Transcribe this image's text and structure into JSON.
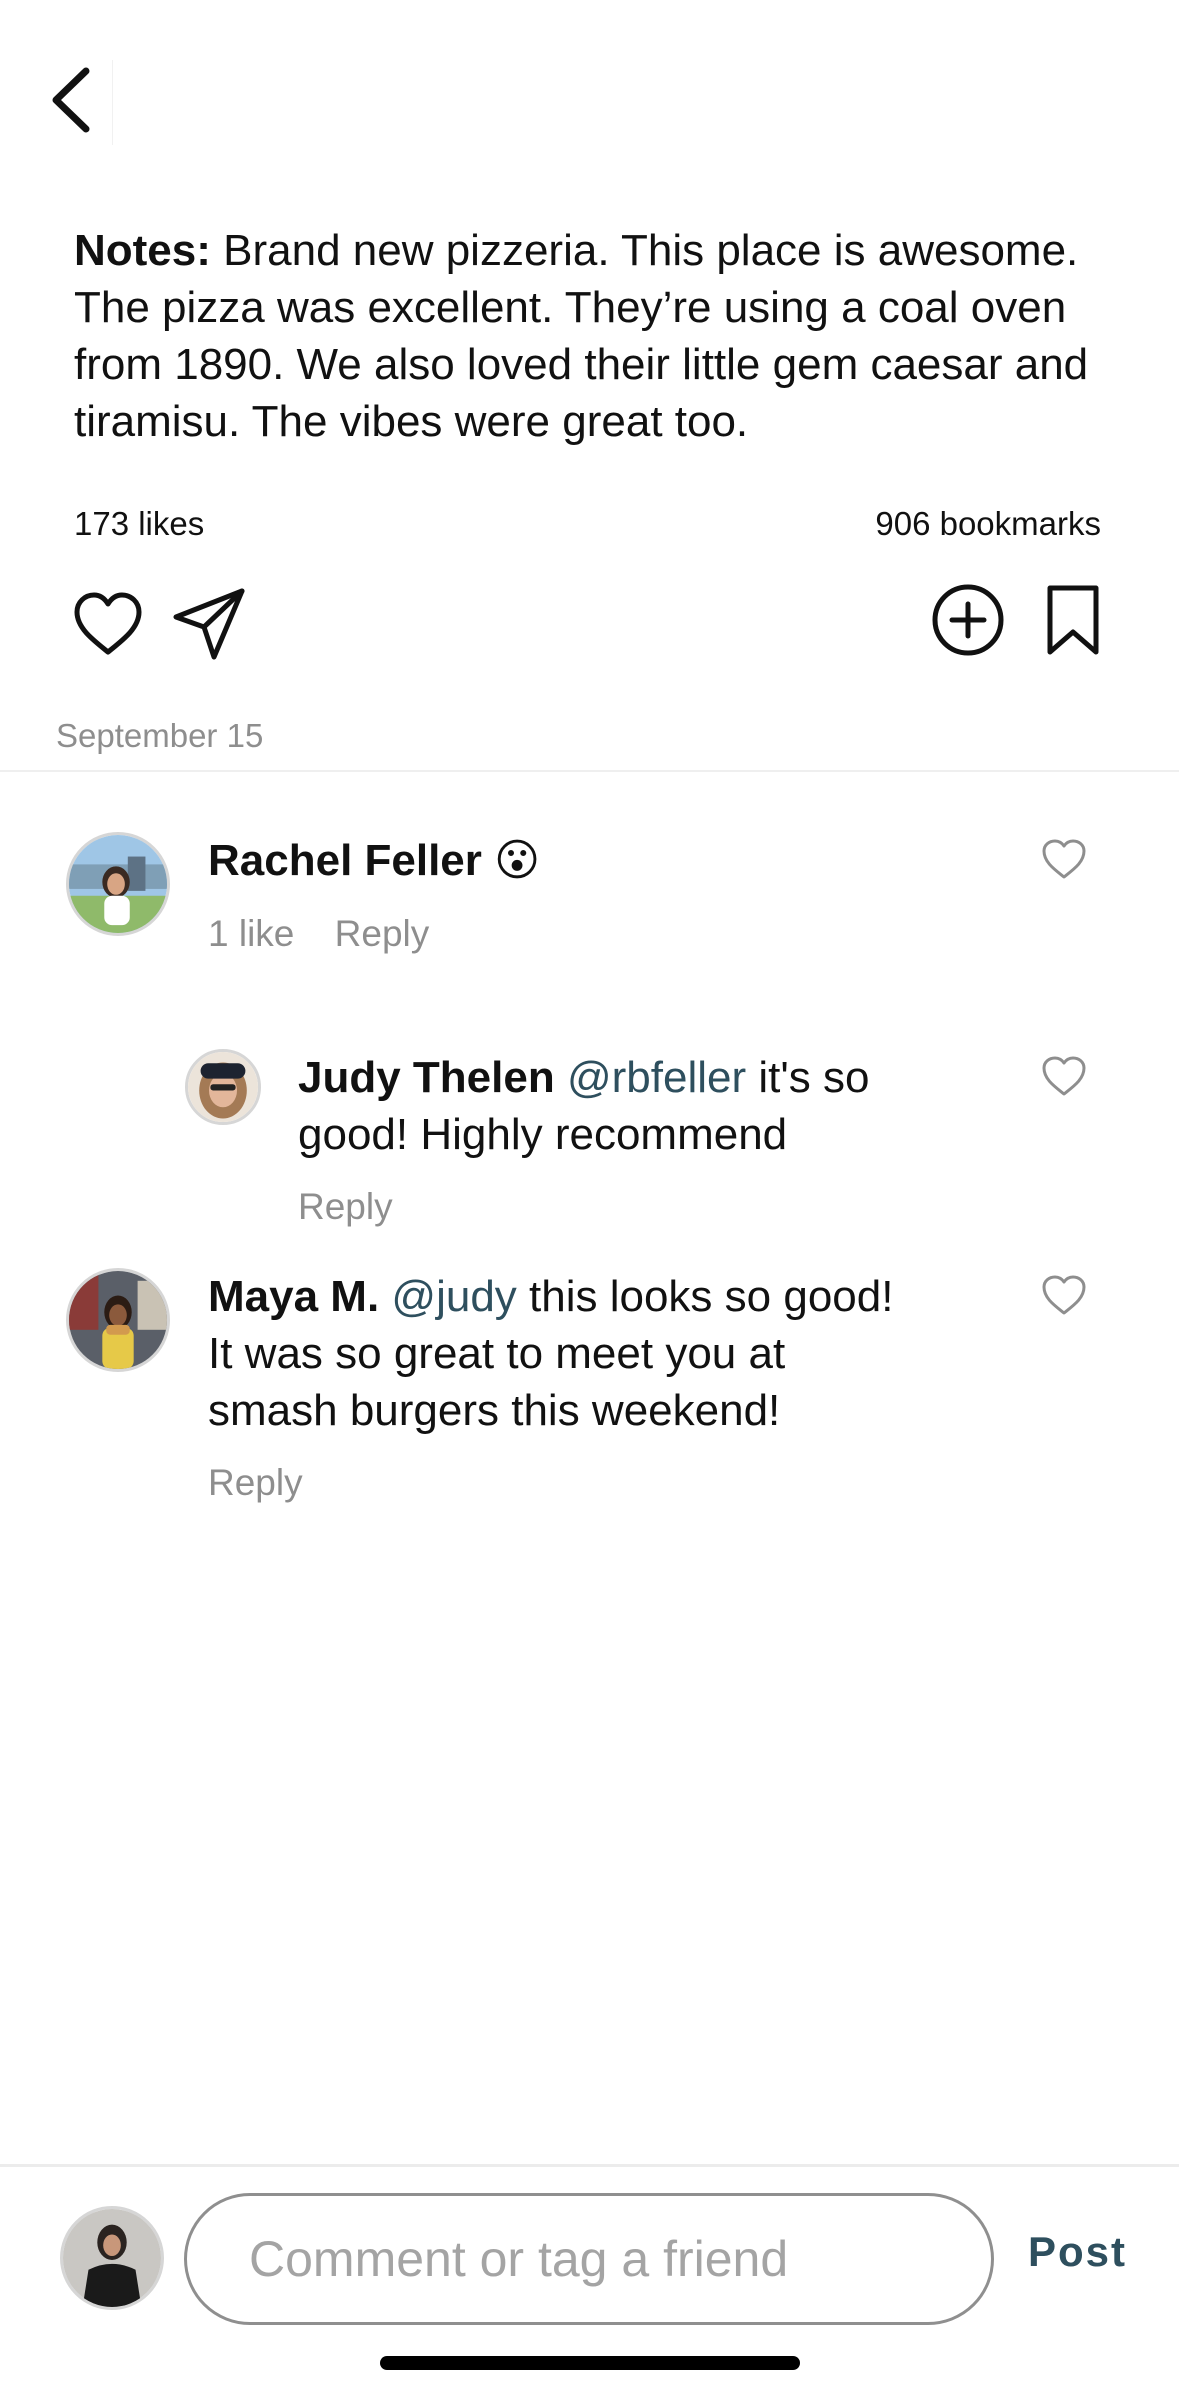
{
  "header": {
    "back_icon": "chevron-left-icon"
  },
  "post": {
    "notes_label": "Notes:",
    "notes_text": " Brand new pizzeria. This place is awesome. The pizza was excellent. They’re using a coal oven from 1890. We also loved their little gem caesar and tiramisu. The vibes were great too.",
    "likes": "173 likes",
    "bookmarks": "906 bookmarks",
    "date": "September 15",
    "actions": [
      "heart-icon",
      "send-icon",
      "plus-circle-icon",
      "bookmark-icon"
    ]
  },
  "comments": [
    {
      "name": "Rachel Feller",
      "emoji": "😮",
      "likes": "1 like",
      "reply_label": "Reply"
    },
    {
      "name": "Judy Thelen",
      "mention": "@rbfeller",
      "text_line1": " it's so",
      "text_line2": "good! Highly recommend",
      "reply_label": "Reply"
    },
    {
      "name": "Maya M.",
      "mention": "@judy",
      "text_line1": " this looks so good!",
      "text_line2": "It was so great to meet you at",
      "text_line3": "smash burgers this weekend!",
      "reply_label": "Reply"
    }
  ],
  "composer": {
    "placeholder": "Comment or tag a friend",
    "value": "",
    "post_label": "Post"
  },
  "colors": {
    "mention": "#2e4f5e",
    "muted": "#8e8e8e",
    "text": "#111111"
  }
}
